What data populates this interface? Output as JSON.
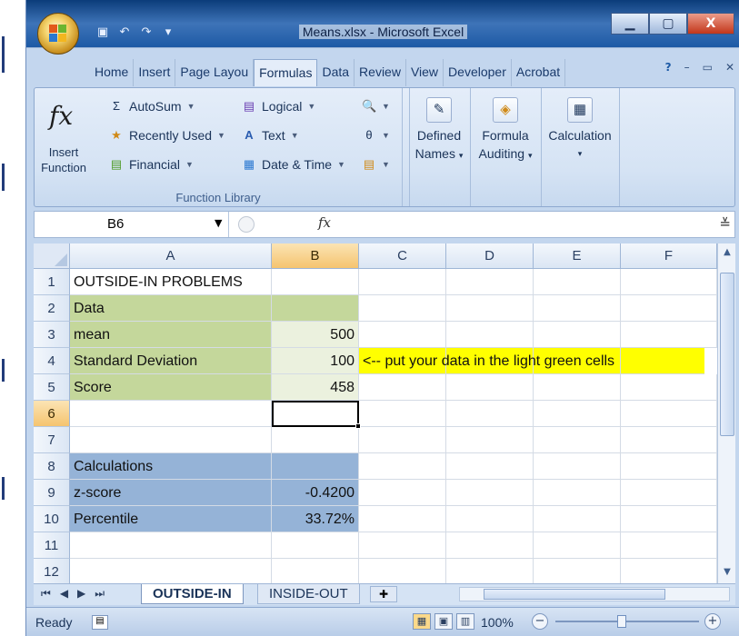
{
  "window": {
    "title": "Means.xlsx - Microsoft Excel",
    "minimize_icon": "minimize-icon",
    "restore_icon": "restore-icon",
    "close_label": "X"
  },
  "quick_access": [
    "save-icon",
    "undo-icon",
    "redo-icon",
    "customize-icon"
  ],
  "ribbon_tabs": [
    {
      "label": "Home",
      "active": false
    },
    {
      "label": "Insert",
      "active": false
    },
    {
      "label": "Page Layou",
      "active": false
    },
    {
      "label": "Formulas",
      "active": true
    },
    {
      "label": "Data",
      "active": false
    },
    {
      "label": "Review",
      "active": false
    },
    {
      "label": "View",
      "active": false
    },
    {
      "label": "Developer",
      "active": false
    },
    {
      "label": "Acrobat",
      "active": false
    }
  ],
  "ribbon": {
    "insert_function": {
      "line1": "Insert",
      "line2": "Function"
    },
    "function_library": {
      "label": "Function Library",
      "autosum": "AutoSum",
      "recently_used": "Recently Used",
      "financial": "Financial",
      "logical": "Logical",
      "text": "Text",
      "date_time": "Date & Time"
    },
    "defined_names": {
      "line1": "Defined",
      "line2": "Names"
    },
    "formula_auditing": {
      "line1": "Formula",
      "line2": "Auditing"
    },
    "calculation": {
      "label": "Calculation"
    }
  },
  "formula_bar": {
    "name_box": "B6",
    "fx": "fx",
    "content": ""
  },
  "columns": [
    "A",
    "B",
    "C",
    "D",
    "E",
    "F"
  ],
  "selected_column": "B",
  "rows": [
    {
      "n": "1",
      "a": "OUTSIDE-IN PROBLEMS",
      "b": "",
      "note": ""
    },
    {
      "n": "2",
      "a": "Data",
      "b": "",
      "note": ""
    },
    {
      "n": "3",
      "a": "mean",
      "b": "500",
      "note": ""
    },
    {
      "n": "4",
      "a": "Standard Deviation",
      "b": "100",
      "note": "<-- put your data in the light green cells"
    },
    {
      "n": "5",
      "a": "Score",
      "b": "458",
      "note": ""
    },
    {
      "n": "6",
      "a": "",
      "b": "",
      "note": ""
    },
    {
      "n": "7",
      "a": "",
      "b": "",
      "note": ""
    },
    {
      "n": "8",
      "a": "Calculations",
      "b": "",
      "note": ""
    },
    {
      "n": "9",
      "a": "z-score",
      "b": "-0.4200",
      "note": ""
    },
    {
      "n": "10",
      "a": "Percentile",
      "b": "33.72%",
      "note": ""
    },
    {
      "n": "11",
      "a": "",
      "b": "",
      "note": ""
    },
    {
      "n": "12",
      "a": "",
      "b": "",
      "note": ""
    }
  ],
  "selected_row": "6",
  "colors": {
    "data_green": "#c4d79b",
    "input_light_green": "#ebf1de",
    "calc_blue": "#95b3d7",
    "note_yellow": "#ffff00"
  },
  "sheet_tabs": [
    {
      "label": "OUTSIDE-IN",
      "active": true
    },
    {
      "label": "INSIDE-OUT",
      "active": false
    }
  ],
  "status_bar": {
    "status": "Ready",
    "zoom": "100%"
  }
}
